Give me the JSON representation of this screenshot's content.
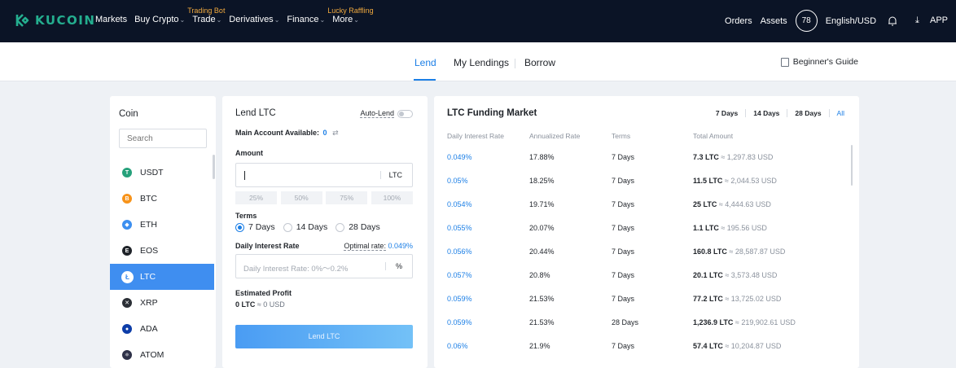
{
  "brand": {
    "name": "KUCOIN"
  },
  "nav": {
    "items": [
      {
        "label": "Markets",
        "tag": ""
      },
      {
        "label": "Buy Crypto",
        "tag": ""
      },
      {
        "label": "Trade",
        "tag": "Trading Bot"
      },
      {
        "label": "Derivatives",
        "tag": ""
      },
      {
        "label": "Finance",
        "tag": ""
      },
      {
        "label": "More",
        "tag": "Lucky Raffling"
      }
    ],
    "orders": "Orders",
    "assets": "Assets",
    "badge": "78",
    "language": "English/USD",
    "app": "APP"
  },
  "subnav": {
    "tabs": [
      "Lend",
      "My Lendings",
      "Borrow"
    ],
    "guide": "Beginner's Guide"
  },
  "coins": {
    "title": "Coin",
    "search_placeholder": "Search",
    "items": [
      {
        "symbol": "USDT",
        "color": "#26a17b",
        "glyph": "T"
      },
      {
        "symbol": "BTC",
        "color": "#f7931a",
        "glyph": "B"
      },
      {
        "symbol": "ETH",
        "color": "#3c8ff0",
        "glyph": "◆"
      },
      {
        "symbol": "EOS",
        "color": "#1f2329",
        "glyph": "E"
      },
      {
        "symbol": "LTC",
        "color": "#ffffff",
        "glyph": "Ł"
      },
      {
        "symbol": "XRP",
        "color": "#2b2f36",
        "glyph": "✕"
      },
      {
        "symbol": "ADA",
        "color": "#0d3da8",
        "glyph": "●"
      },
      {
        "symbol": "ATOM",
        "color": "#2e3148",
        "glyph": "⚛"
      }
    ]
  },
  "lend": {
    "title": "Lend LTC",
    "auto_lend": "Auto-Lend",
    "available_label": "Main Account Available:",
    "available_value": "0",
    "amount_label": "Amount",
    "amount_unit": "LTC",
    "percents": [
      "25%",
      "50%",
      "75%",
      "100%"
    ],
    "terms_label": "Terms",
    "terms": [
      "7 Days",
      "14 Days",
      "28 Days"
    ],
    "rate_label": "Daily Interest Rate",
    "optimal_label": "Optimal rate:",
    "optimal_value": "0.049%",
    "rate_placeholder": "Daily Interest Rate: 0%～0.2%",
    "rate_unit": "%",
    "est_label": "Estimated Profit",
    "est_value": "0 LTC",
    "est_usd": "≈ 0 USD",
    "button": "Lend LTC"
  },
  "market": {
    "title": "LTC Funding Market",
    "filters": [
      "7 Days",
      "14 Days",
      "28 Days",
      "All"
    ],
    "headers": [
      "Daily Interest Rate",
      "Annualized Rate",
      "Terms",
      "Total Amount"
    ],
    "rows": [
      {
        "rate": "0.049%",
        "annual": "17.88%",
        "term": "7 Days",
        "amount": "7.3 LTC",
        "usd": "≈ 1,297.83 USD"
      },
      {
        "rate": "0.05%",
        "annual": "18.25%",
        "term": "7 Days",
        "amount": "11.5 LTC",
        "usd": "≈ 2,044.53 USD"
      },
      {
        "rate": "0.054%",
        "annual": "19.71%",
        "term": "7 Days",
        "amount": "25 LTC",
        "usd": "≈ 4,444.63 USD"
      },
      {
        "rate": "0.055%",
        "annual": "20.07%",
        "term": "7 Days",
        "amount": "1.1 LTC",
        "usd": "≈ 195.56 USD"
      },
      {
        "rate": "0.056%",
        "annual": "20.44%",
        "term": "7 Days",
        "amount": "160.8 LTC",
        "usd": "≈ 28,587.87 USD"
      },
      {
        "rate": "0.057%",
        "annual": "20.8%",
        "term": "7 Days",
        "amount": "20.1 LTC",
        "usd": "≈ 3,573.48 USD"
      },
      {
        "rate": "0.059%",
        "annual": "21.53%",
        "term": "7 Days",
        "amount": "77.2 LTC",
        "usd": "≈ 13,725.02 USD"
      },
      {
        "rate": "0.059%",
        "annual": "21.53%",
        "term": "28 Days",
        "amount": "1,236.9 LTC",
        "usd": "≈ 219,902.61 USD"
      },
      {
        "rate": "0.06%",
        "annual": "21.9%",
        "term": "7 Days",
        "amount": "57.4 LTC",
        "usd": "≈ 10,204.87 USD"
      }
    ]
  }
}
